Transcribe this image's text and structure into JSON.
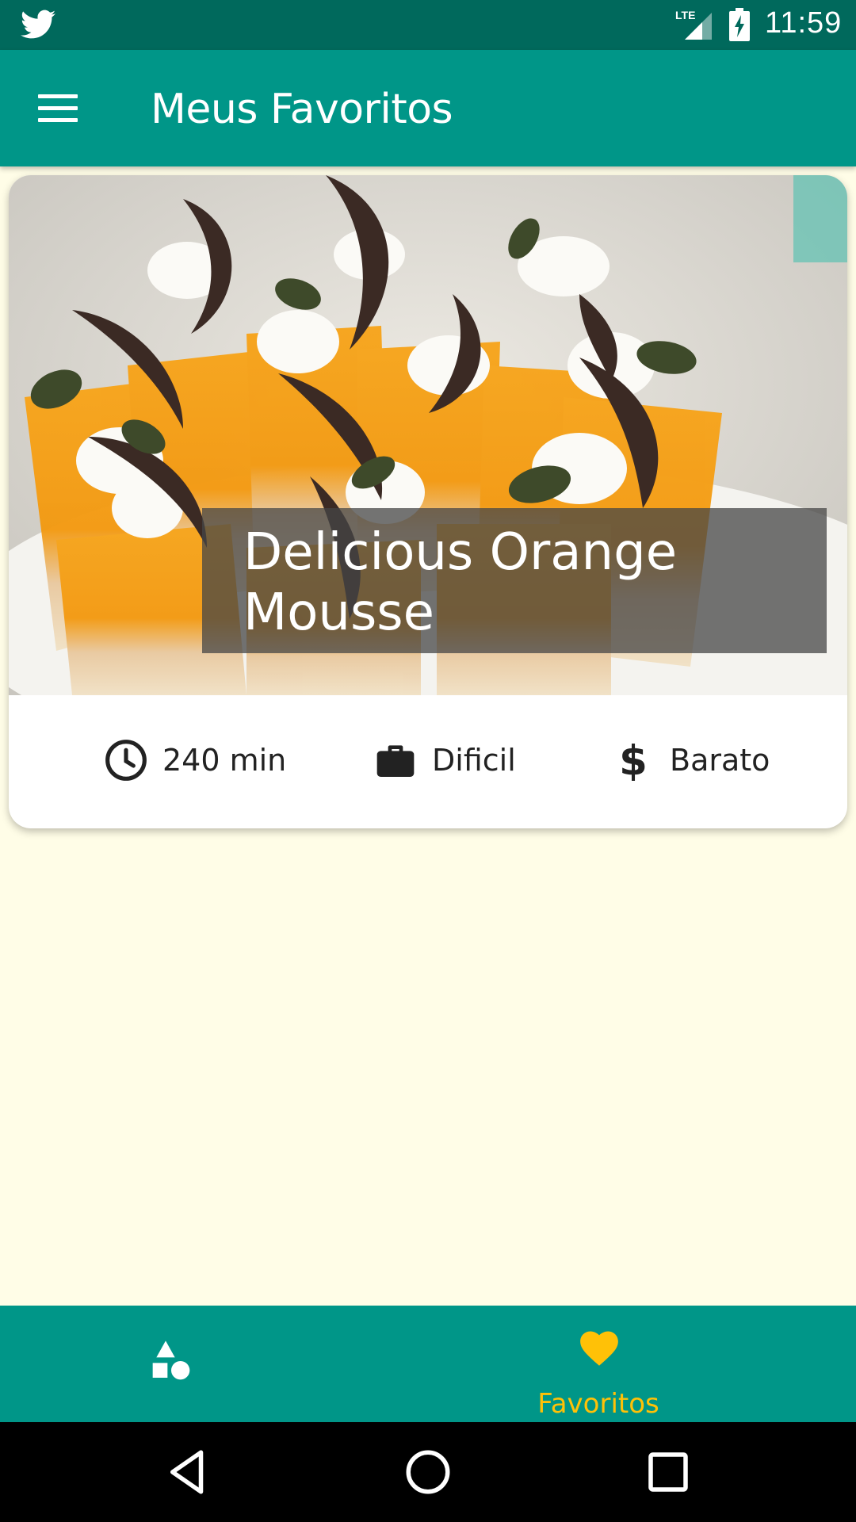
{
  "status_bar": {
    "time": "11:59",
    "network": "LTE",
    "app_notification_icon": "twitter-icon"
  },
  "app_bar": {
    "title": "Meus Favoritos",
    "menu_icon": "hamburger-menu-icon"
  },
  "meal_card": {
    "title": "Delicious Orange Mousse",
    "duration": "240 min",
    "complexity": "Dificil",
    "affordability": "Barato"
  },
  "bottom_nav": {
    "items": [
      {
        "icon": "categories-shapes-icon",
        "label": "",
        "selected": false
      },
      {
        "icon": "heart-icon",
        "label": "Favoritos",
        "selected": true
      }
    ]
  },
  "colors": {
    "primary": "#009688",
    "primary_dark": "#00695C",
    "accent": "#FFC107",
    "background": "#FFFDE7"
  }
}
